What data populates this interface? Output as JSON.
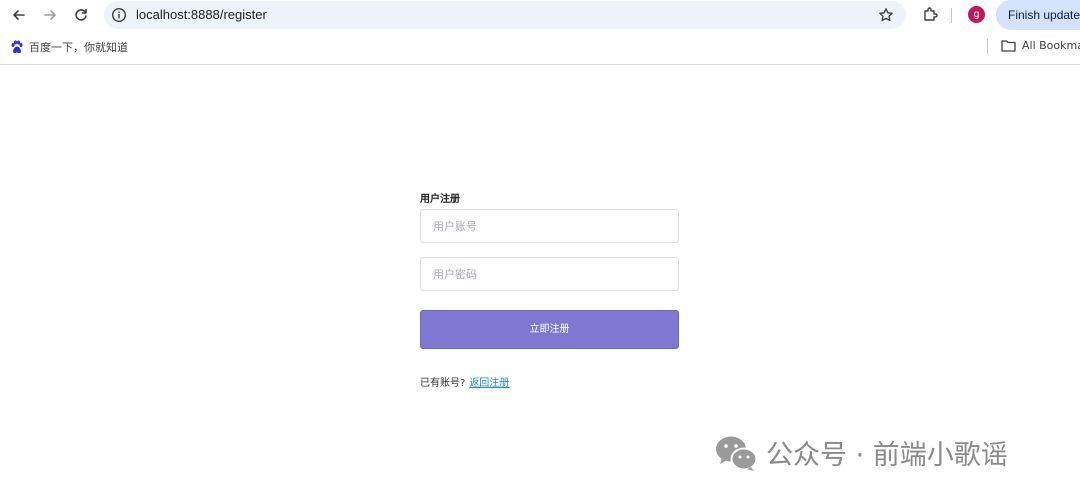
{
  "browser": {
    "url": "localhost:8888/register",
    "profile_initial": "g",
    "update_label": "Finish update",
    "bookmarks": [
      {
        "icon": "baidu-paw-icon",
        "label": "百度一下，你就知道"
      }
    ],
    "all_bookmarks_label": "All Bookmar"
  },
  "register": {
    "title": "用户注册",
    "username_placeholder": "用户账号",
    "password_placeholder": "用户密码",
    "submit_label": "立即注册",
    "has_account_text": "已有账号?",
    "back_link_label": "返回注册"
  },
  "watermark": {
    "icon": "wechat-icon",
    "text": "公众号 · 前端小歌谣"
  },
  "colors": {
    "submit_button": "#7f77d1",
    "link": "#1f8ad6",
    "omnibox_bg": "#eef2fb",
    "update_button_bg": "#d3e3fd",
    "avatar_bg": "#c2185b"
  }
}
